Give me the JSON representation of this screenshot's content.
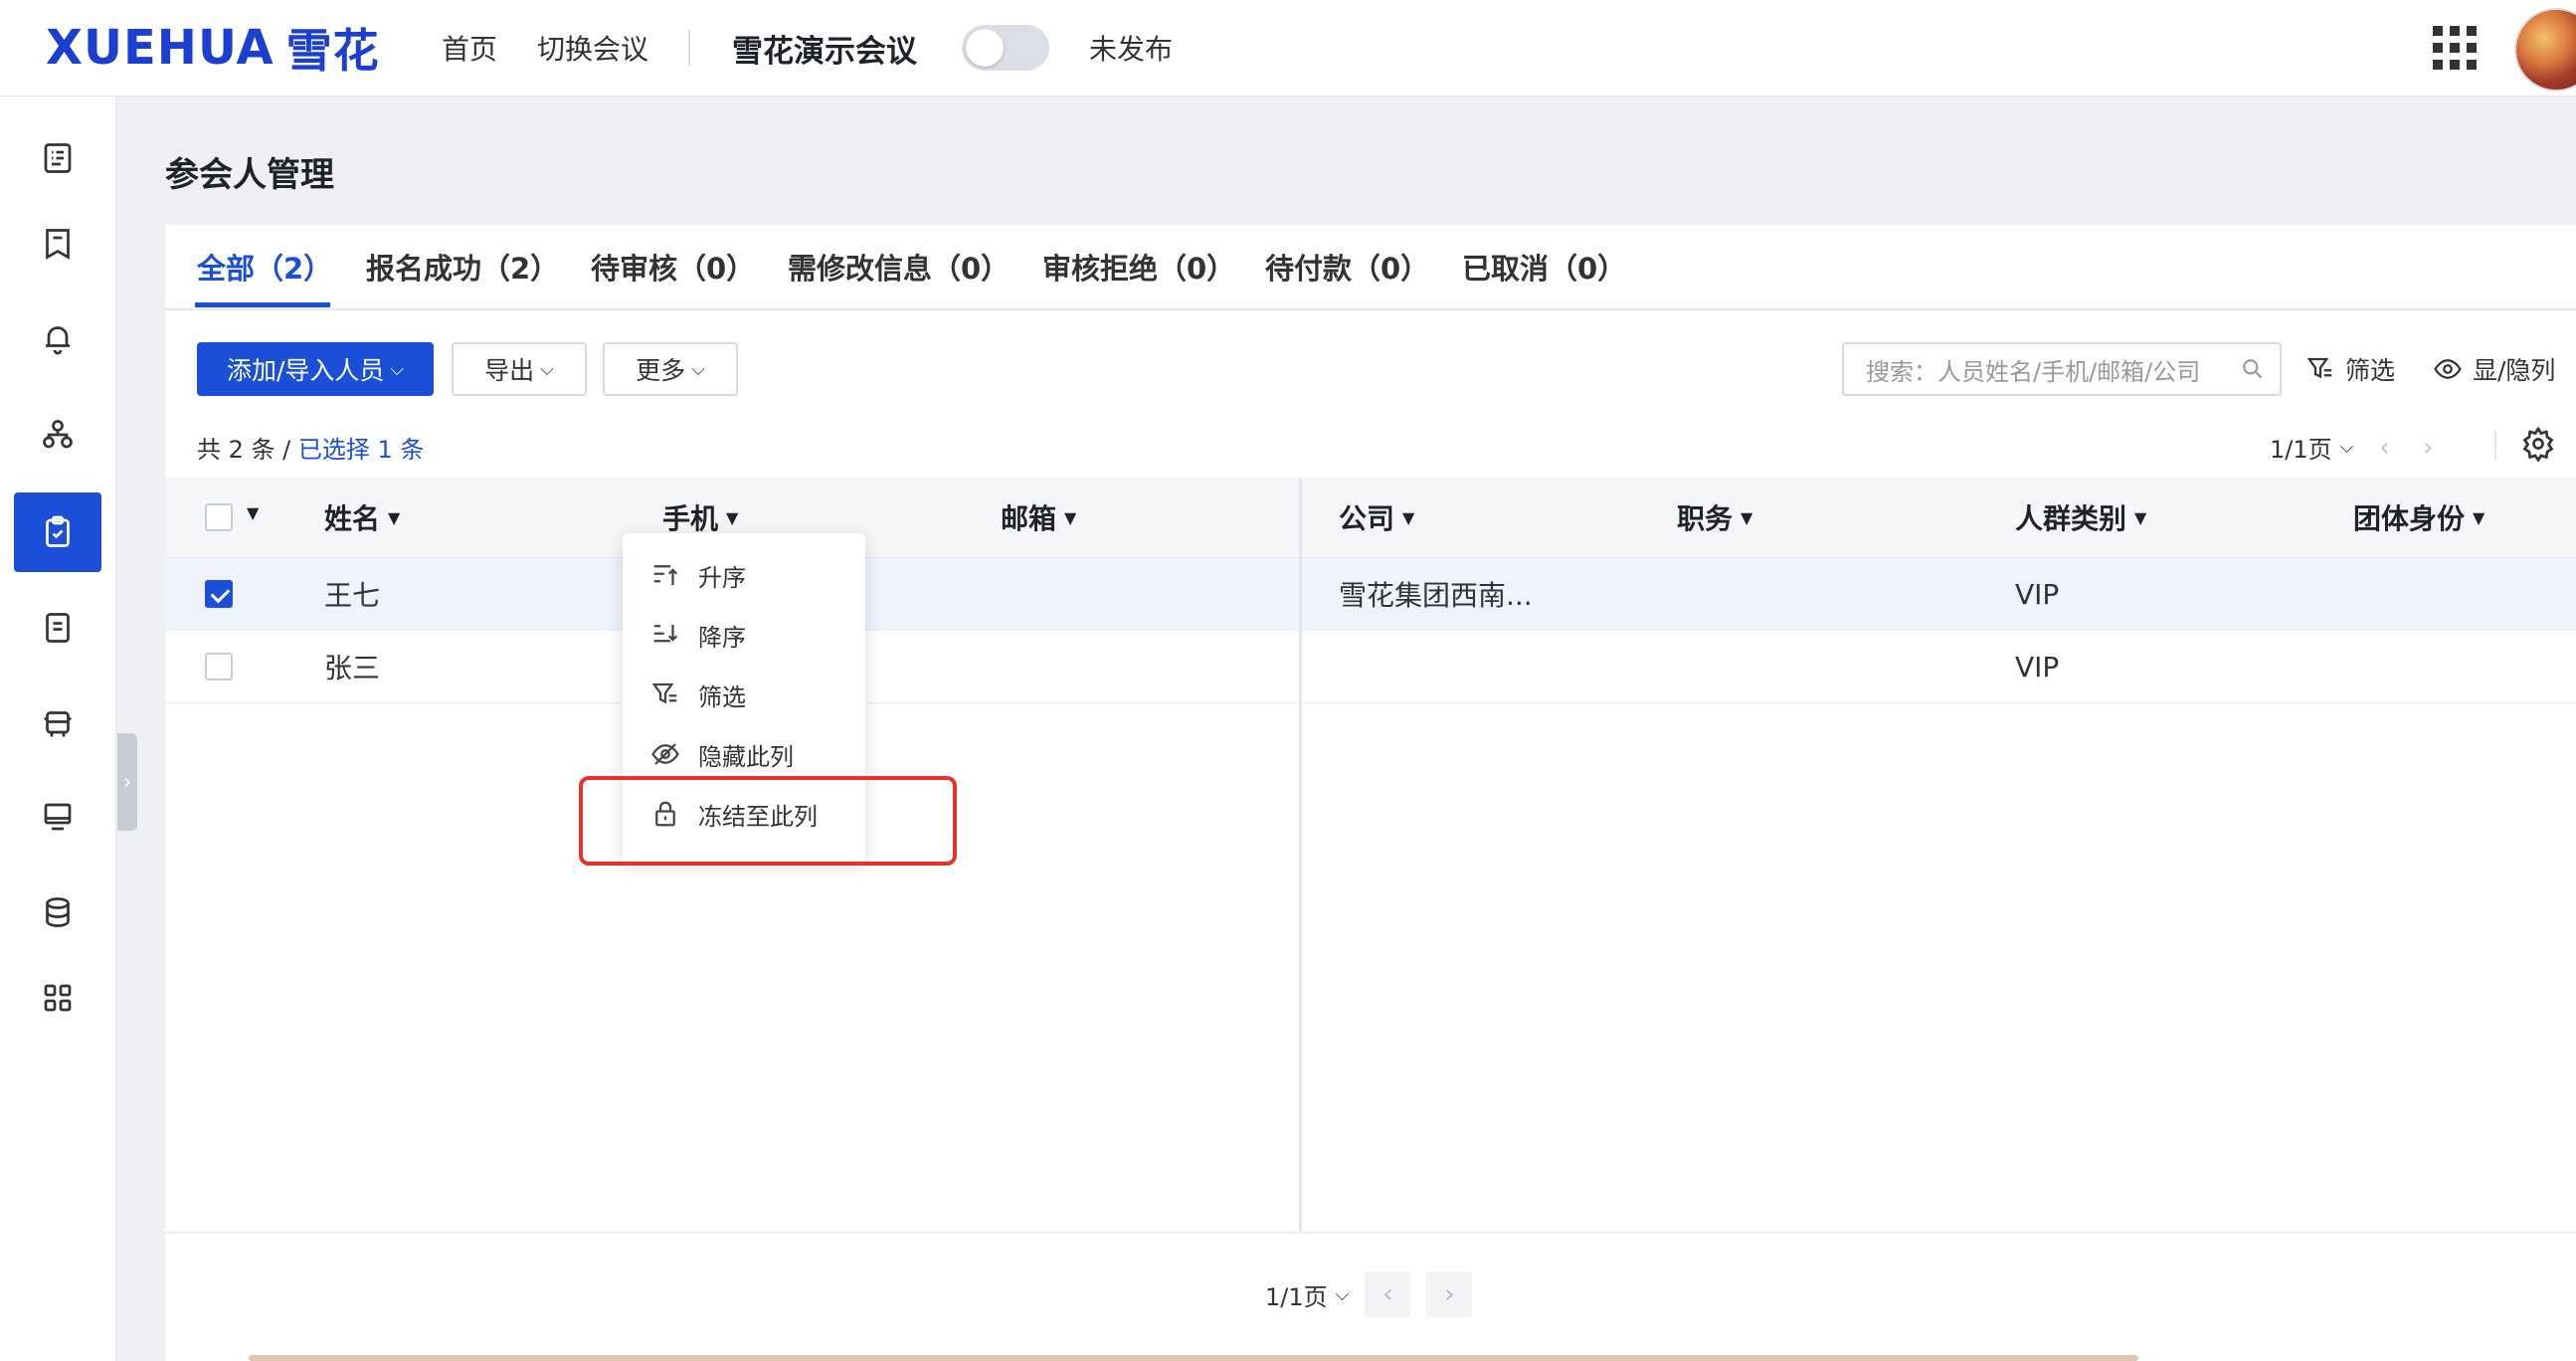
{
  "header": {
    "logo_text": "XUEHUA",
    "logo_cn": "雪花",
    "nav_home": "首页",
    "nav_switch": "切换会议",
    "conference_title": "雪花演示会议",
    "publish_status": "未发布",
    "brand_color": "#1b4fd8"
  },
  "sidebar": {
    "items": [
      {
        "icon": "list-doc-icon"
      },
      {
        "icon": "bookmark-icon"
      },
      {
        "icon": "bell-icon"
      },
      {
        "icon": "org-chart-icon"
      },
      {
        "icon": "clipboard-check-icon",
        "active": true
      },
      {
        "icon": "document-icon"
      },
      {
        "icon": "bus-icon"
      },
      {
        "icon": "monitor-icon"
      },
      {
        "icon": "database-icon"
      },
      {
        "icon": "grid-apps-icon"
      }
    ]
  },
  "page": {
    "title": "参会人管理"
  },
  "tabs": [
    {
      "label": "全部（2）",
      "active": true
    },
    {
      "label": "报名成功（2）"
    },
    {
      "label": "待审核（0）"
    },
    {
      "label": "需修改信息（0）"
    },
    {
      "label": "审核拒绝（0）"
    },
    {
      "label": "待付款（0）"
    },
    {
      "label": "已取消（0）"
    }
  ],
  "toolbar": {
    "add_label": "添加/导入人员",
    "export_label": "导出",
    "more_label": "更多",
    "search_placeholder": "搜索：人员姓名/手机/邮箱/公司",
    "filter_label": "筛选",
    "visibility_label": "显/隐列"
  },
  "summary": {
    "total_text": "共 2 条 / ",
    "selected_text": "已选择 1 条",
    "page_text": "1/1页"
  },
  "table": {
    "columns": [
      "姓名",
      "手机",
      "邮箱",
      "公司",
      "职务",
      "人群类别",
      "团体身份"
    ],
    "rows": [
      {
        "checked": true,
        "name": "王七",
        "phone": "",
        "email": "",
        "company": "雪花集团西南...",
        "title": "",
        "category": "VIP",
        "group": ""
      },
      {
        "checked": false,
        "name": "张三",
        "phone": "",
        "email": "",
        "company": "",
        "title": "",
        "category": "VIP",
        "group": ""
      }
    ]
  },
  "column_menu": {
    "items": [
      {
        "label": "升序",
        "icon": "sort-asc-icon"
      },
      {
        "label": "降序",
        "icon": "sort-desc-icon"
      },
      {
        "label": "筛选",
        "icon": "filter-icon"
      },
      {
        "label": "隐藏此列",
        "icon": "eye-off-icon"
      },
      {
        "label": "冻结至此列",
        "icon": "lock-icon"
      }
    ]
  },
  "footer_pager": {
    "page_text": "1/1页"
  }
}
